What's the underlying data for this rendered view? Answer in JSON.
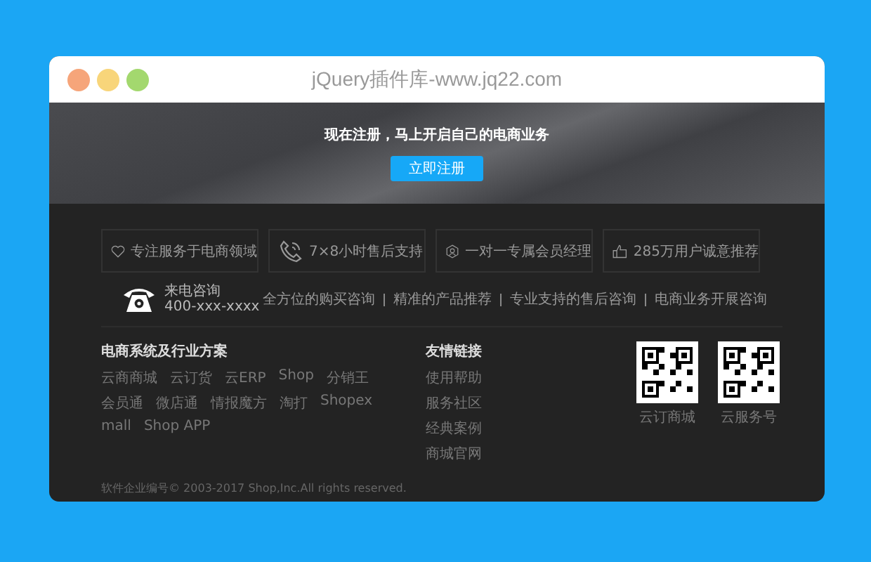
{
  "window": {
    "title": "jQuery插件库-www.jq22.com"
  },
  "banner": {
    "heading": "现在注册，马上开启自己的电商业务",
    "button": "立即注册"
  },
  "features": [
    {
      "kind": "heart",
      "label": "专注服务于电商领域"
    },
    {
      "kind": "phone",
      "label": "7×8小时售后支持"
    },
    {
      "kind": "user",
      "label": "一对一专属会员经理"
    },
    {
      "kind": "thumb",
      "label": "285万用户诚意推荐"
    }
  ],
  "contact": {
    "label": "来电咨询",
    "phone": "400-xxx-xxxx"
  },
  "services": [
    "全方位的购买咨询",
    "精准的产品推荐",
    "专业支持的售后咨询",
    "电商业务开展咨询"
  ],
  "solutions": {
    "heading": "电商系统及行业方案",
    "links": [
      "云商商城",
      "云订货",
      "云ERP",
      "Shop",
      "分销王",
      "会员通",
      "微店通",
      "情报魔方",
      "淘打",
      "Shopex",
      "mall",
      "Shop APP"
    ]
  },
  "friend_links": {
    "heading": "友情链接",
    "links": [
      "使用帮助",
      "服务社区",
      "经典案例",
      "商城官网"
    ]
  },
  "qr_codes": [
    {
      "caption": "云订商城"
    },
    {
      "caption": "云服务号"
    }
  ],
  "copyright": "软件企业编号© 2003-2017 Shop,Inc.All rights reserved."
}
